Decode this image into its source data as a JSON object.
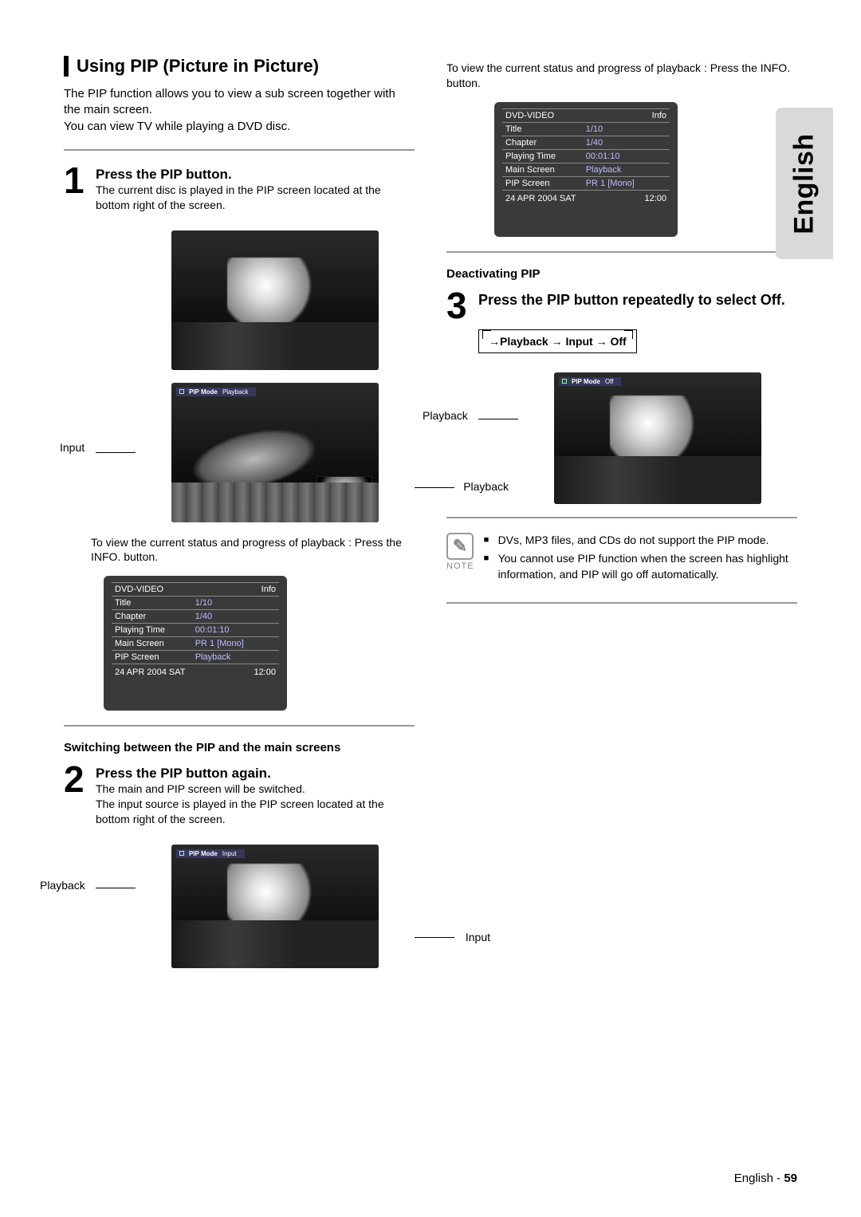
{
  "sideTab": "English",
  "sectionTitle": "Using PIP (Picture in Picture)",
  "intro": "The PIP function allows you to view a sub screen together with the main screen.\nYou can view TV while playing a DVD disc.",
  "step1": {
    "num": "1",
    "title": "Press the PIP button.",
    "body": "The current disc is played in the PIP screen located at the bottom right of the screen.",
    "labelLeft": "Input",
    "labelRight": "Playback",
    "osdStrip": {
      "mode": "PIP Mode",
      "value": "Playback"
    },
    "afterText": "To view the current status and progress of playback : Press the INFO. button."
  },
  "osd1": {
    "header": "DVD-VIDEO",
    "info": "Info",
    "rows": [
      {
        "k": "Title",
        "v": "1/10"
      },
      {
        "k": "Chapter",
        "v": "1/40"
      },
      {
        "k": "Playing Time",
        "v": "00:01:10"
      },
      {
        "k": "Main Screen",
        "v": "PR 1 [Mono]"
      },
      {
        "k": "PIP Screen",
        "v": "Playback"
      }
    ],
    "date": "24 APR 2004 SAT",
    "time": "12:00"
  },
  "switchHead": "Switching between the PIP and the main screens",
  "step2": {
    "num": "2",
    "title": "Press the PIP button again.",
    "body": "The main and PIP screen will be switched.\nThe input source is played in the PIP screen located at the bottom right of the screen.",
    "labelLeft": "Playback",
    "labelRight": "Input",
    "osdStrip": {
      "mode": "PIP Mode",
      "value": "Input"
    }
  },
  "rightIntro": "To view the current status and progress of playback : Press the INFO. button.",
  "osd2": {
    "header": "DVD-VIDEO",
    "info": "Info",
    "rows": [
      {
        "k": "Title",
        "v": "1/10"
      },
      {
        "k": "Chapter",
        "v": "1/40"
      },
      {
        "k": "Playing Time",
        "v": "00:01:10"
      },
      {
        "k": "Main Screen",
        "v": "Playback"
      },
      {
        "k": "PIP Screen",
        "v": "PR 1 [Mono]"
      }
    ],
    "date": "24 APR 2004 SAT",
    "time": "12:00"
  },
  "deactHead": "Deactivating PIP",
  "step3": {
    "num": "3",
    "title": "Press the PIP button repeatedly to select Off.",
    "cycle": "→Playback → Input → Off",
    "labelLeft": "Playback",
    "osdStrip": {
      "mode": "PIP Mode",
      "value": "Off"
    }
  },
  "note": {
    "label": "NOTE",
    "items": [
      "DVs, MP3 files, and CDs do not support the PIP mode.",
      "You cannot use PIP function when the screen has highlight information, and PIP will go off automatically."
    ]
  },
  "footer": {
    "lang": "English",
    "sep": " - ",
    "page": "59"
  }
}
